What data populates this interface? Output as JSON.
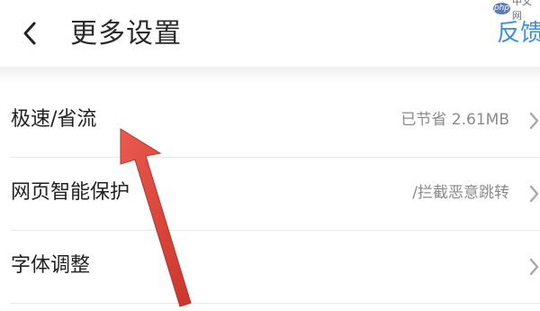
{
  "header": {
    "title": "更多设置",
    "feedback_label": "反馈",
    "back_icon": "chevron-left-icon"
  },
  "watermark": {
    "logo": "php",
    "text": "中文网"
  },
  "settings": {
    "items": [
      {
        "label": "极速/省流",
        "value": "已节省 2.61MB",
        "icon": "chevron-right-icon"
      },
      {
        "label": "网页智能保护",
        "value": "/拦截恶意跳转",
        "icon": "chevron-right-icon"
      },
      {
        "label": "字体调整",
        "value": "",
        "icon": "chevron-right-icon"
      }
    ]
  },
  "colors": {
    "accent": "#3f8fdc",
    "annotation_arrow": "#e0443a"
  }
}
